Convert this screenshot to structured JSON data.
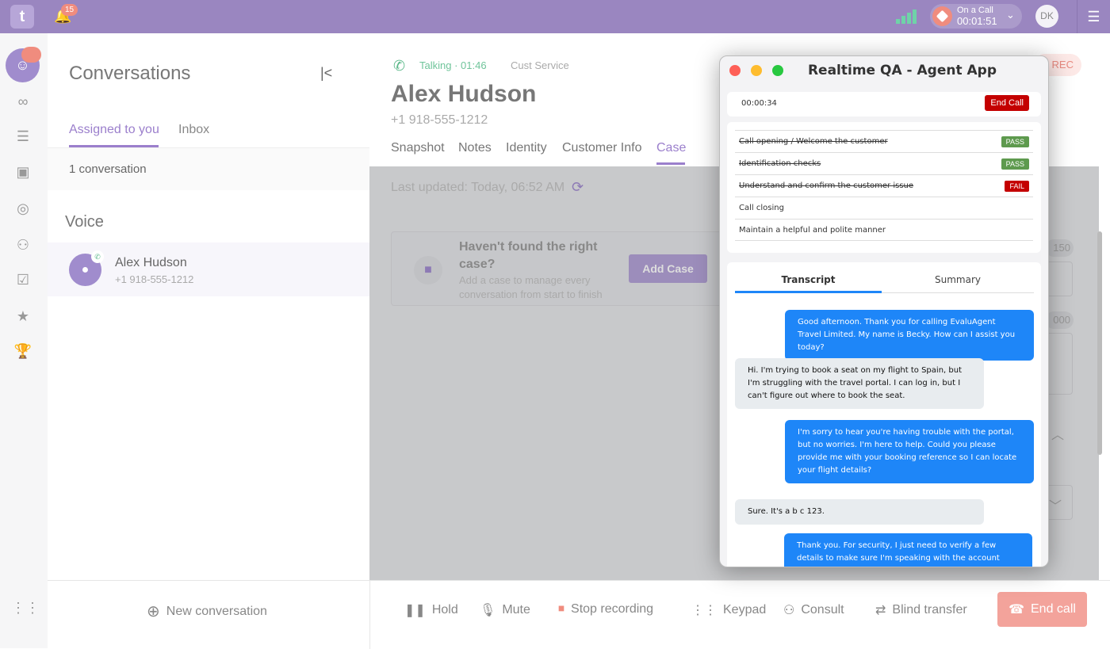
{
  "topbar": {
    "logo": "t",
    "notifications": "15",
    "call_status": "On a Call",
    "call_timer": "00:01:51",
    "user_initials": "DK"
  },
  "sidebar": {
    "items": [
      "conversations-icon",
      "voicemail-icon",
      "queue-icon",
      "contacts-icon",
      "agent-icon",
      "teams-icon",
      "tasks-icon",
      "skills-icon",
      "trophy-icon",
      "apps-grid-icon"
    ]
  },
  "conversations": {
    "title": "Conversations",
    "tabs": [
      "Assigned to you",
      "Inbox"
    ],
    "count": "1 conversation",
    "section": "Voice",
    "items": [
      {
        "name": "Alex Hudson",
        "phone": "+1 918-555-1212"
      }
    ],
    "new_label": "New conversation"
  },
  "contact": {
    "status": "Talking · 01:46",
    "queue": "Cust Service",
    "name": "Alex Hudson",
    "phone": "+1 918-555-1212",
    "rec": "REC",
    "tabs": [
      "Snapshot",
      "Notes",
      "Identity",
      "Customer Info",
      "Case"
    ],
    "last_updated": "Last updated: Today, 06:52 AM",
    "case_title": "Haven't found the right case?",
    "case_desc": "Add a case to manage every conversation from start to finish",
    "add_case": "Add Case",
    "partial_values": [
      "150",
      "000"
    ]
  },
  "callbar": {
    "hold": "Hold",
    "mute": "Mute",
    "stop_recording": "Stop recording",
    "keypad": "Keypad",
    "consult": "Consult",
    "blind_transfer": "Blind transfer",
    "end_call": "End call"
  },
  "qa": {
    "title": "Realtime QA - Agent App",
    "timer": "00:00:34",
    "end_call": "End Call",
    "checks": [
      {
        "label": "Call opening / Welcome the customer",
        "result": "PASS"
      },
      {
        "label": "Identification checks",
        "result": "PASS"
      },
      {
        "label": "Understand and confirm the customer issue",
        "result": "FAIL"
      },
      {
        "label": "Call closing",
        "result": ""
      },
      {
        "label": "Maintain a helpful and polite manner",
        "result": ""
      }
    ],
    "tabs": [
      "Transcript",
      "Summary"
    ],
    "messages": [
      {
        "role": "agent",
        "text": "Good afternoon. Thank you for calling EvaluAgent Travel Limited. My name is Becky. How can I assist you today?"
      },
      {
        "role": "cust",
        "text": "Hi. I'm trying to book a seat on my flight to Spain, but I'm struggling with the travel portal. I can log in, but I can't figure out where to book the seat."
      },
      {
        "role": "agent",
        "text": "I'm sorry to hear you're having trouble with the portal, but no worries. I'm here to help. Could you please provide me with your booking reference so I can locate your flight details?"
      },
      {
        "role": "cust",
        "text": "Sure. It's a b c 123."
      },
      {
        "role": "agent",
        "text": "Thank you. For security, I just need to verify a few details to make sure I'm speaking with the account"
      }
    ]
  },
  "colors": {
    "brand": "#9a86c0",
    "pass": "#5e9a4e",
    "fail": "#c40000",
    "agent_bubble": "#1e86f8"
  }
}
